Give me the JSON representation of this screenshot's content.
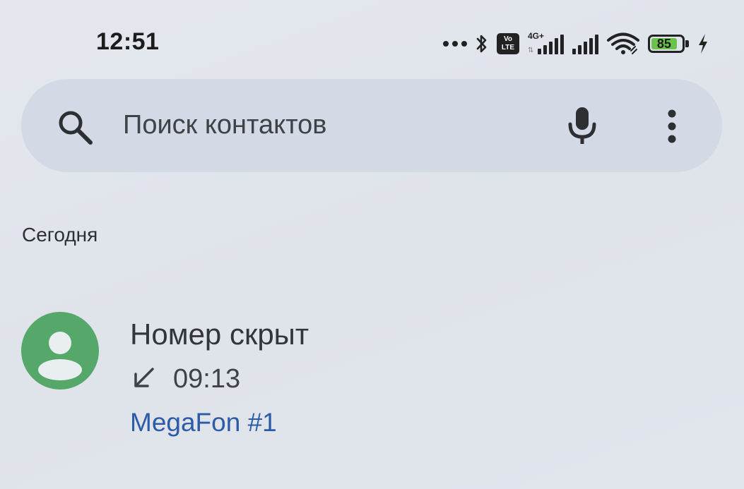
{
  "status_bar": {
    "time": "12:51",
    "volte_top": "Vo",
    "volte_bottom": "LTE",
    "network_type": "4G+",
    "battery_level": "85",
    "icons": [
      "more-dots-icon",
      "bluetooth-icon",
      "volte-icon",
      "signal-4g-icon",
      "signal-icon",
      "wifi-icon",
      "battery-icon",
      "charging-icon"
    ]
  },
  "search": {
    "placeholder": "Поиск контактов",
    "icons": [
      "search-icon",
      "mic-icon",
      "more-vert-icon"
    ]
  },
  "history": {
    "section_label": "Сегодня",
    "calls": [
      {
        "name": "Номер скрыт",
        "direction": "incoming",
        "direction_icon": "call-received-icon",
        "time": "09:13",
        "sim": "MegaFon #1",
        "avatar_icon": "person-icon",
        "avatar_color": "#55a86a"
      }
    ]
  },
  "colors": {
    "background": "#e1e5ec",
    "search_bar": "#d3dae5",
    "accent_link": "#2c5ba8",
    "battery_fill": "#6cc24a"
  }
}
